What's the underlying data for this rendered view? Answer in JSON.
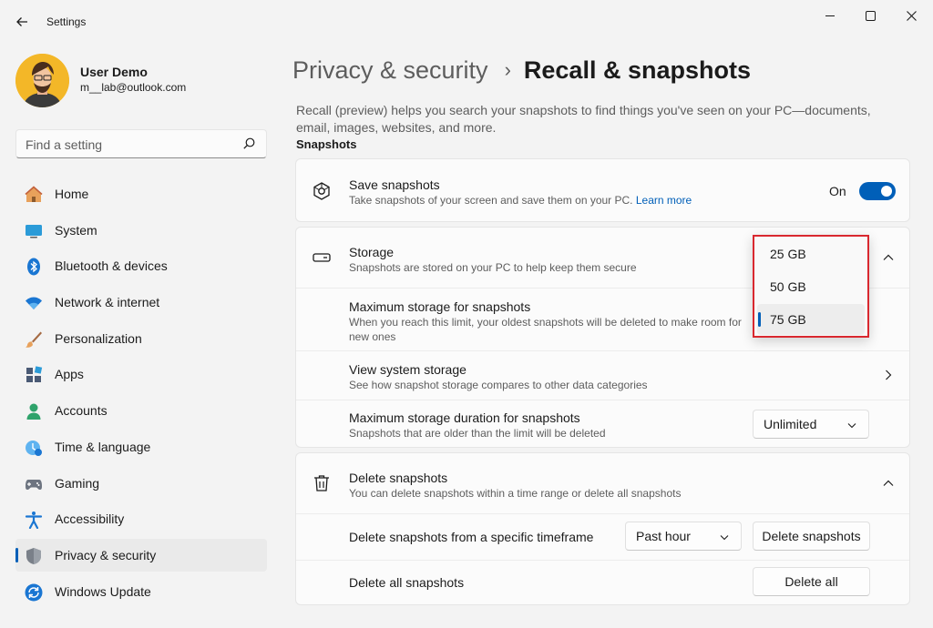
{
  "window": {
    "title": "Settings"
  },
  "profile": {
    "name": "User Demo",
    "email": "m__lab@outlook.com"
  },
  "search": {
    "placeholder": "Find a setting"
  },
  "nav": {
    "items": [
      {
        "label": "Home",
        "icon": "home-icon"
      },
      {
        "label": "System",
        "icon": "system-icon"
      },
      {
        "label": "Bluetooth & devices",
        "icon": "bluetooth-icon"
      },
      {
        "label": "Network & internet",
        "icon": "wifi-icon"
      },
      {
        "label": "Personalization",
        "icon": "brush-icon"
      },
      {
        "label": "Apps",
        "icon": "apps-icon"
      },
      {
        "label": "Accounts",
        "icon": "accounts-icon"
      },
      {
        "label": "Time & language",
        "icon": "time-language-icon"
      },
      {
        "label": "Gaming",
        "icon": "gaming-icon"
      },
      {
        "label": "Accessibility",
        "icon": "accessibility-icon"
      },
      {
        "label": "Privacy & security",
        "icon": "shield-icon",
        "active": true
      },
      {
        "label": "Windows Update",
        "icon": "windows-update-icon"
      }
    ]
  },
  "breadcrumb": {
    "parent": "Privacy & security",
    "separator": "›",
    "current": "Recall & snapshots"
  },
  "intro": "Recall (preview) helps you search your snapshots to find things you've seen on your PC—documents, email, images, websites, and more.",
  "section": {
    "title": "Snapshots"
  },
  "save_snapshots": {
    "title": "Save snapshots",
    "subtitle": "Take snapshots of your screen and save them on your PC.",
    "link": "Learn more",
    "toggle_label": "On",
    "enabled": true
  },
  "storage": {
    "title": "Storage",
    "subtitle": "Snapshots are stored on your PC to help keep them secure",
    "max_storage": {
      "title": "Maximum storage for snapshots",
      "subtitle": "When you reach this limit, your oldest snapshots will be deleted to make room for new ones",
      "options": [
        "25 GB",
        "50 GB",
        "75 GB"
      ],
      "selected": "75 GB"
    },
    "view_system": {
      "title": "View system storage",
      "subtitle": "See how snapshot storage compares to other data categories"
    },
    "max_duration": {
      "title": "Maximum storage duration for snapshots",
      "subtitle": "Snapshots that are older than the limit will be deleted",
      "value": "Unlimited"
    }
  },
  "delete": {
    "title": "Delete snapshots",
    "subtitle": "You can delete snapshots within a time range or delete all snapshots",
    "timeframe": {
      "label": "Delete snapshots from a specific timeframe",
      "value": "Past hour",
      "button": "Delete snapshots"
    },
    "all": {
      "label": "Delete all snapshots",
      "button": "Delete all"
    }
  },
  "colors": {
    "accent": "#005fb8",
    "highlight_border": "#d9282f",
    "background": "#f3f3f3",
    "card": "#fbfbfb"
  }
}
